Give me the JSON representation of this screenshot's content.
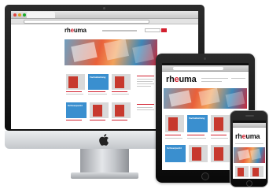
{
  "site": {
    "logo_prefix": "rh",
    "logo_accent": "e",
    "logo_suffix": "uma",
    "brand_color": "#d2202f"
  },
  "imac": {
    "tile_labels": [
      "Fachabteilung",
      "Schwerpunkt",
      "Fachabteilung",
      "Schwerpunkt"
    ]
  },
  "ipad": {
    "tile_labels": [
      "Fachabteilung",
      "Schwerpunkt",
      "Fachabteilung",
      "Schwerpunkt"
    ]
  },
  "icons": {
    "apple": "apple-logo-icon"
  }
}
